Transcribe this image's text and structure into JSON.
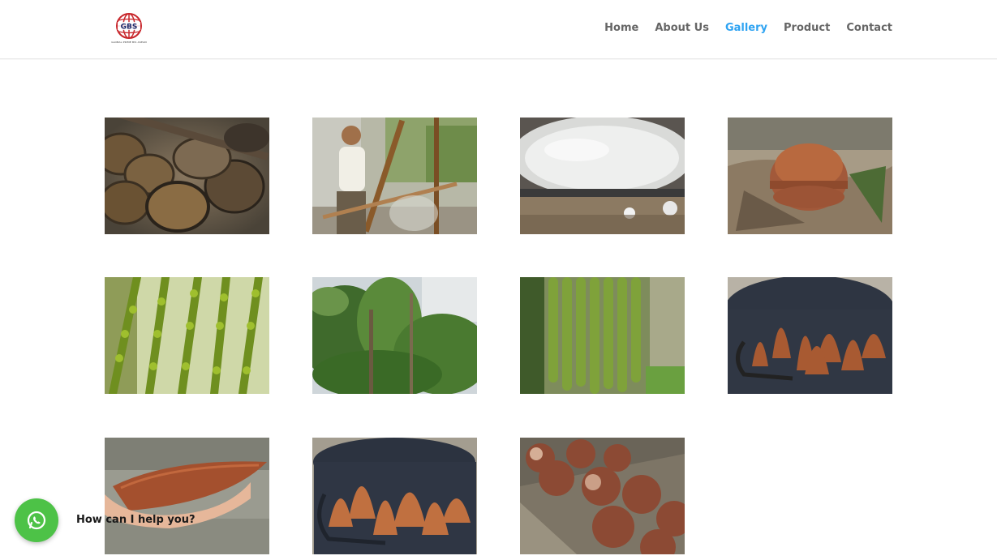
{
  "header": {
    "logo_text": "GBS",
    "logo_caption": "GLOBAL PRIME BIS ASEAN",
    "nav": {
      "home": "Home",
      "about": "About Us",
      "gallery": "Gallery",
      "product": "Product",
      "contact": "Contact"
    },
    "active_color": "#2ea3f2",
    "nav_color": "#666666"
  },
  "gallery": {
    "items": [
      {
        "subject": "coconut-shell-molds"
      },
      {
        "subject": "man-tapping-palm-sap"
      },
      {
        "subject": "boiling-sap-in-wok"
      },
      {
        "subject": "palm-sugar-on-leaves"
      },
      {
        "subject": "palm-fruit-strands-closeup"
      },
      {
        "subject": "palm-trees-forest"
      },
      {
        "subject": "palm-fruit-hanging-strands"
      },
      {
        "subject": "palm-sugar-cones-in-bucket"
      },
      {
        "subject": "palm-sugar-cone-in-hand"
      },
      {
        "subject": "palm-sugar-cones-in-bucket-2"
      },
      {
        "subject": "palm-sugar-domes-in-tray"
      }
    ]
  },
  "chat": {
    "icon": "whatsapp-icon",
    "label": "How can I help you?",
    "color": "#4dc247"
  }
}
